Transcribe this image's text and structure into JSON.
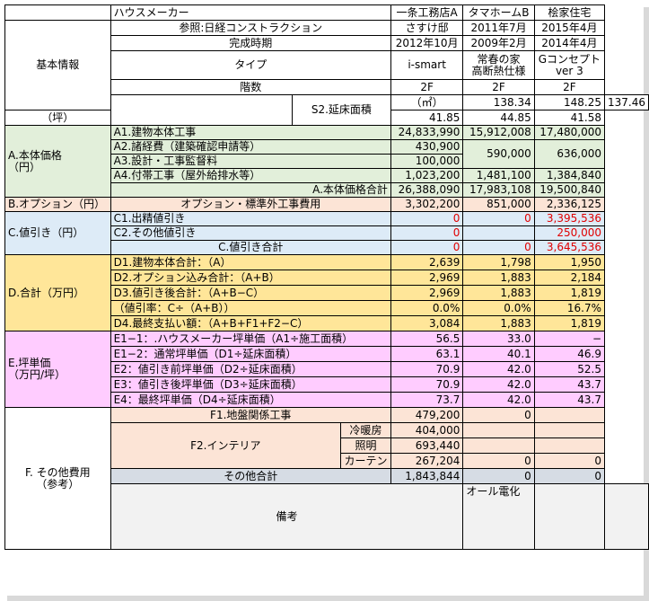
{
  "header": {
    "maker_label": "ハウスメーカー",
    "maker_a": "一条工務店A",
    "maker_b": "タマホームB",
    "maker_c": "桧家住宅",
    "ref_label": "参照:日経コンストラクション",
    "ref_a": "さすけ邸",
    "completion_label": "完成時期",
    "completion_a": "2012年10月",
    "completion_b1": "2011年7月",
    "completion_b2": "2009年2月",
    "completion_c1": "2015年4月",
    "completion_c2": "2014年4月",
    "type_label": "タイプ",
    "type_a": "i-smart",
    "type_b1": "常春の家",
    "type_b2": "高断熱仕様",
    "type_c1": "Gコンセプト",
    "type_c2": "ver 3",
    "floors_label": "階数",
    "floors_a": "2F",
    "floors_b": "2F",
    "floors_c": "2F",
    "basic_info": "基本情報",
    "s2_label": "S2.延床面積",
    "unit_m2": "（㎡）",
    "unit_tsubo": "（坪）",
    "area_m2": [
      "138.34",
      "148.25",
      "137.46"
    ],
    "area_tsubo": [
      "41.85",
      "44.85",
      "41.58"
    ]
  },
  "sectionA": {
    "title1": "A.本体価格",
    "title2": "（円）",
    "a1_label": "A1.建物本体工事",
    "a1": [
      "24,833,990",
      "15,912,008",
      "17,480,000"
    ],
    "a2_label": "A2.諸経費（建築確認申請等）",
    "a2_a": "430,900",
    "a23_b": "590,000",
    "a23_c": "636,000",
    "a3_label": "A3.設計・工事監督料",
    "a3_a": "100,000",
    "a4_label": "A4.付帯工事（屋外給排水等）",
    "a4": [
      "1,023,200",
      "1,481,100",
      "1,384,840"
    ],
    "total_label": "A.本体価格合計",
    "total": [
      "26,388,090",
      "17,983,108",
      "19,500,840"
    ]
  },
  "sectionB": {
    "title": "B.オプション（円）",
    "label": "オプション・標準外工事費用",
    "values": [
      "3,302,200",
      "851,000",
      "2,336,125"
    ]
  },
  "sectionC": {
    "title": "C.値引き（円）",
    "c1_label": "C1.出精値引き",
    "c1": [
      "0",
      "0",
      "3,395,536"
    ],
    "c2_label": "C2.その他値引き",
    "c2": [
      "0",
      "",
      "250,000"
    ],
    "total_label": "C.値引き合計",
    "total": [
      "0",
      "0",
      "3,645,536"
    ]
  },
  "sectionD": {
    "title": "D.合計（万円）",
    "d1_label": "D1.建物本体合計：（A）",
    "d1": [
      "2,639",
      "1,798",
      "1,950"
    ],
    "d2_label": "D2.オプション込み合計：（A+B）",
    "d2": [
      "2,969",
      "1,883",
      "2,184"
    ],
    "d3_label": "D3.値引き後合計：（A+B−C）",
    "d3": [
      "2,969",
      "1,883",
      "1,819"
    ],
    "rate_label": "（値引率：C÷（A+B））",
    "rate": [
      "0.0%",
      "0.0%",
      "16.7%"
    ],
    "d4_label": "D4.最終支払い額：（A+B+F1+F2−C）",
    "d4": [
      "3,084",
      "1,883",
      "1,819"
    ]
  },
  "sectionE": {
    "title1": "E.坪単価",
    "title2": "（万円/坪）",
    "e11_label": "E1−1：.ハウスメーカー坪単価（A1÷施工面積）",
    "e11": [
      "56.5",
      "33.0",
      "−"
    ],
    "e12_label": "E1−2：通常坪単価（D1÷延床面積）",
    "e12": [
      "63.1",
      "40.1",
      "46.9"
    ],
    "e2_label": "E2：値引き前坪単価（D2÷延床面積）",
    "e2": [
      "70.9",
      "42.0",
      "52.5"
    ],
    "e3_label": "E3：値引き後坪単価（D3÷延床面積）",
    "e3": [
      "70.9",
      "42.0",
      "43.7"
    ],
    "e4_label": "E4：最終坪単価（D4÷延床面積）",
    "e4": [
      "73.7",
      "42.0",
      "43.7"
    ]
  },
  "sectionF": {
    "title1": "F. その他費用",
    "title2": "（参考）",
    "f1_label": "F1.地盤関係工事",
    "f1": [
      "479,200",
      "0",
      ""
    ],
    "f2_label": "F2.インテリア",
    "hvac_label": "冷暖房",
    "hvac": [
      "404,000",
      "",
      ""
    ],
    "light_label": "照明",
    "light": [
      "693,440",
      "",
      ""
    ],
    "curtain_label": "カーテン",
    "curtain": [
      "267,204",
      "0",
      "0"
    ],
    "total_label": "その他合計",
    "total": [
      "1,843,844",
      "0",
      "0"
    ]
  },
  "remarks": {
    "label": "備考",
    "a": "オール電化",
    "b": "",
    "c": ""
  }
}
